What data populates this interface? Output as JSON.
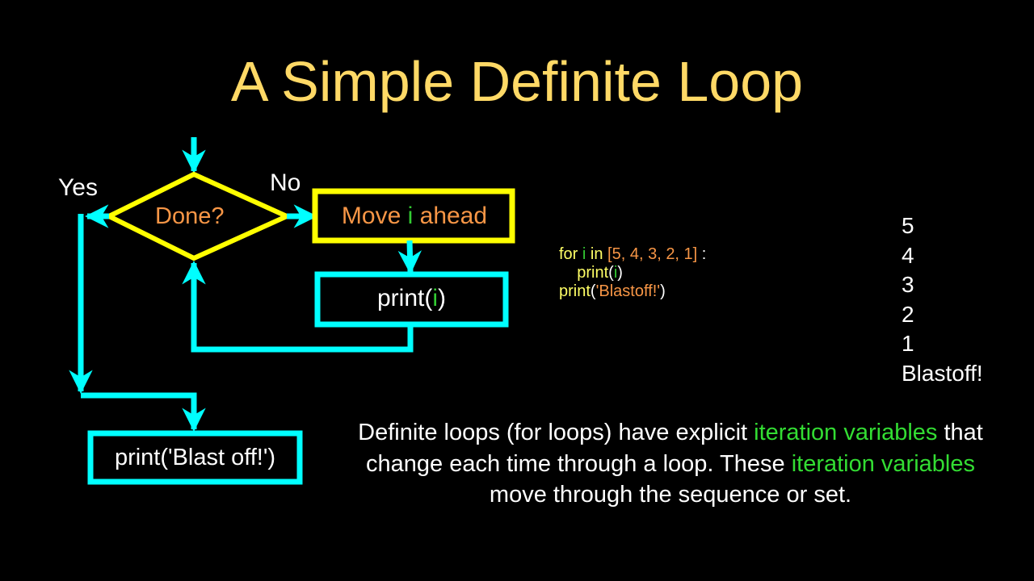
{
  "slide": {
    "title": "A Simple Definite Loop"
  },
  "flowchart": {
    "decision": {
      "label": "Done?"
    },
    "yes_label": "Yes",
    "no_label": "No",
    "move_box": {
      "pre": "Move ",
      "var": "i",
      "post": " ahead"
    },
    "print_i_box": {
      "pre": "print(",
      "var": "i",
      "post": ")"
    },
    "blast_box": {
      "label": "print('Blast off!')"
    }
  },
  "code": {
    "line1": {
      "kw_for": "for ",
      "var": "i",
      "kw_in": " in ",
      "seq": "[5, 4, 3, 2, 1]",
      "colon": " :"
    },
    "line2": {
      "indent": "    ",
      "fn": "print",
      "open": "(",
      "var": "i",
      "close": ")"
    },
    "line3": {
      "fn": "print",
      "open": "(",
      "str": "'Blastoff!'",
      "close": ")"
    }
  },
  "output": {
    "lines": [
      "5",
      "4",
      "3",
      "2",
      "1",
      "Blastoff!"
    ]
  },
  "description": {
    "part1": "Definite loops (for loops) have explicit ",
    "hl1": "iteration variables",
    "part2": " that change each time through a loop.  These ",
    "hl2": "iteration variables",
    "part3": " move through the sequence or set."
  },
  "colors": {
    "background": "#000000",
    "title": "#FFD966",
    "decision_stroke": "#FFFF00",
    "process_stroke": "#00FFFF",
    "label_orange": "#F79646",
    "variable_green": "#33CC33",
    "keyword_yellow": "#FFFF66"
  }
}
